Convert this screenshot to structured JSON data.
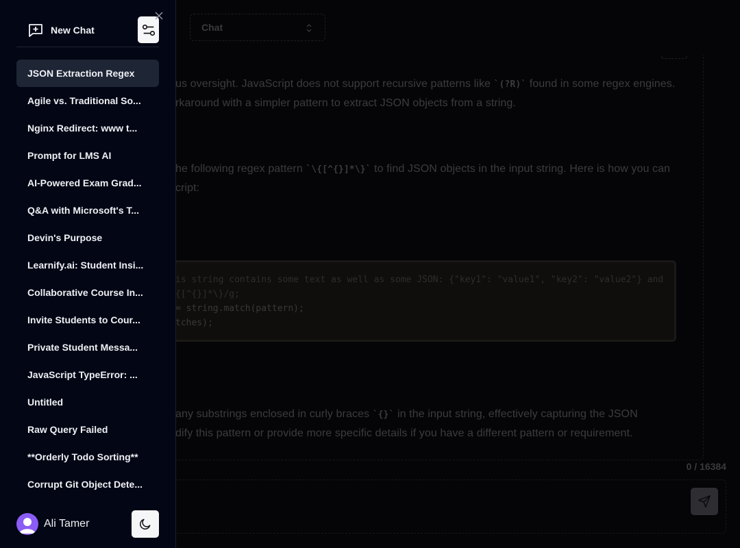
{
  "sidebar": {
    "new_chat_label": "New Chat",
    "chats": [
      {
        "title": "JSON Extraction Regex",
        "active": true
      },
      {
        "title": "Agile vs. Traditional So..."
      },
      {
        "title": "Nginx Redirect: www t..."
      },
      {
        "title": "Prompt for LMS AI"
      },
      {
        "title": "AI-Powered Exam Grad..."
      },
      {
        "title": "Q&A with Microsoft's T..."
      },
      {
        "title": "Devin's Purpose"
      },
      {
        "title": "Learnify.ai: Student Insi..."
      },
      {
        "title": "Collaborative Course In..."
      },
      {
        "title": "Invite Students to Cour..."
      },
      {
        "title": "Private Student Messa..."
      },
      {
        "title": "JavaScript TypeError: ..."
      },
      {
        "title": "Untitled"
      },
      {
        "title": "Raw Query Failed"
      },
      {
        "title": "**Orderly Todo Sorting**"
      },
      {
        "title": "Corrupt Git Object Dete..."
      }
    ],
    "user": {
      "name": "Ali Tamer",
      "avatar_color": "#8b5cf6"
    },
    "icons": {
      "new_chat": "message-plus-icon",
      "settings": "sliders-icon",
      "close": "close-icon",
      "theme": "moon-icon"
    }
  },
  "header": {
    "mode_select_value": "Chat"
  },
  "conversation": {
    "paragraph1": {
      "line1_pre": "us oversight. JavaScript does not support recursive patterns like ",
      "line1_code": "`(?R)`",
      "line1_post": " found in some regex engines.",
      "line2": "rkaround with a simpler pattern to extract JSON objects from a string."
    },
    "paragraph2": {
      "line1_pre": "he following regex pattern ",
      "line1_code": "`\\{[^{}]*\\}`",
      "line1_post": " to find JSON objects in the input string. Here is how you can",
      "line2": "cript:"
    },
    "code_lines": [
      "is string contains some text as well as some JSON: {\"key1\": \"value1\", \"key2\": \"value2\"} and",
      "{[^{}]*\\}/g;",
      "= string.match(pattern);",
      "tches);"
    ],
    "paragraph3": {
      "line1_pre": "any substrings enclosed in curly braces ",
      "line1_code": "`{}`",
      "line1_post": " in the input string, effectively capturing the JSON",
      "line2": "dify this pattern or provide more specific details if you have a different pattern or requirement."
    }
  },
  "composer": {
    "char_count": "0 / 16384",
    "input_value": "",
    "send_icon": "send-icon"
  }
}
